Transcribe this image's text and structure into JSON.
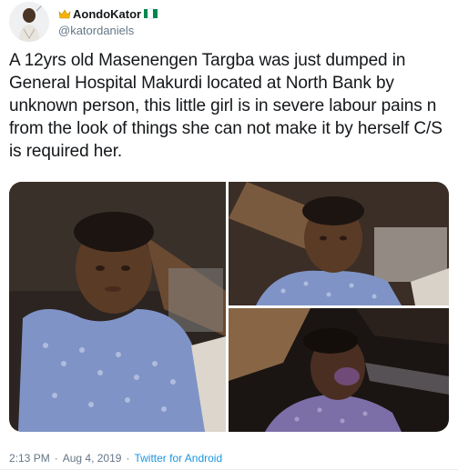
{
  "user": {
    "display_name": "AondoKator",
    "handle": "@katordaniels",
    "flag_colors": [
      "#008751",
      "#ffffff",
      "#008751"
    ]
  },
  "tweet": {
    "text": "A 12yrs old Masenengen Targba was just dumped in General Hospital Makurdi located at North Bank by unknown person, this little girl is in severe labour pains n from the look of things she can not make it by herself C/S is required her."
  },
  "meta": {
    "time": "2:13 PM",
    "separator": "·",
    "date": "Aug 4, 2019",
    "source": "Twitter for Android"
  },
  "colors": {
    "text": "#14171a",
    "secondary": "#657786",
    "link": "#1b95e0"
  }
}
